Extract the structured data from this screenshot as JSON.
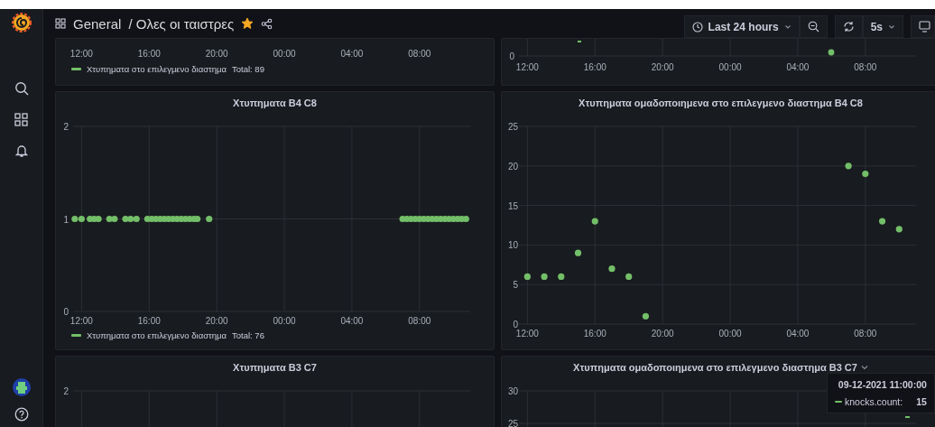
{
  "header": {
    "folder": "General",
    "title": "/ Ολες οι ταιστρες",
    "starred": true,
    "time_range": "Last 24 hours",
    "refresh_interval": "5s"
  },
  "panels": [
    {
      "kind": "top",
      "x_labels": [
        "12:00",
        "16:00",
        "20:00",
        "00:00",
        "04:00",
        "08:00"
      ],
      "legend": {
        "label": "Χτυπηματα στο επιλεγμενο διαστημα",
        "total": "Total: 89",
        "color": "#73bf69"
      }
    },
    {
      "kind": "top",
      "y_labels": [
        "0"
      ],
      "x_labels": [
        "12:00",
        "16:00",
        "20:00",
        "00:00",
        "04:00",
        "08:00"
      ]
    },
    {
      "kind": "chart",
      "title": "Χτυπηματα B4 C8",
      "legend": {
        "total": "Total: 76"
      },
      "chart_data": {
        "type": "scatter",
        "grid": true,
        "x": [
          "2021-12-08 11:36",
          "2021-12-08 12:00",
          "2021-12-08 12:30",
          "2021-12-08 12:45",
          "2021-12-08 13:00",
          "2021-12-08 13:39",
          "2021-12-08 13:57",
          "2021-12-08 14:36",
          "2021-12-08 14:54",
          "2021-12-08 15:15",
          "2021-12-08 15:54",
          "2021-12-08 16:09",
          "2021-12-08 16:24",
          "2021-12-08 16:39",
          "2021-12-08 16:54",
          "2021-12-08 17:09",
          "2021-12-08 17:24",
          "2021-12-08 17:39",
          "2021-12-08 17:54",
          "2021-12-08 18:09",
          "2021-12-08 18:24",
          "2021-12-08 18:39",
          "2021-12-08 18:51",
          "2021-12-08 19:33",
          "2021-12-09 07:00",
          "2021-12-09 07:15",
          "2021-12-09 07:30",
          "2021-12-09 07:45",
          "2021-12-09 08:00",
          "2021-12-09 08:15",
          "2021-12-09 08:30",
          "2021-12-09 08:45",
          "2021-12-09 09:00",
          "2021-12-09 09:15",
          "2021-12-09 09:30",
          "2021-12-09 09:45",
          "2021-12-09 10:00",
          "2021-12-09 10:15",
          "2021-12-09 10:30",
          "2021-12-09 10:45"
        ],
        "series": [
          {
            "name": "Χτυπηματα στο επιλεγμενο διαστημα",
            "color": "#73bf69",
            "values": [
              1,
              1,
              1,
              1,
              1,
              1,
              1,
              1,
              1,
              1,
              1,
              1,
              1,
              1,
              1,
              1,
              1,
              1,
              1,
              1,
              1,
              1,
              1,
              1,
              1,
              1,
              1,
              1,
              1,
              1,
              1,
              1,
              1,
              1,
              1,
              1,
              1,
              1,
              1,
              1
            ]
          }
        ],
        "xlim": [
          "2021-12-08 11:30",
          "2021-12-09 11:00"
        ],
        "ylim": [
          0,
          2
        ],
        "xticks": [
          {
            "value": "2021-12-08 12:00",
            "label": "12:00"
          },
          {
            "value": "2021-12-08 16:00",
            "label": "16:00"
          },
          {
            "value": "2021-12-08 20:00",
            "label": "20:00"
          },
          {
            "value": "2021-12-09 00:00",
            "label": "00:00"
          },
          {
            "value": "2021-12-09 04:00",
            "label": "04:00"
          },
          {
            "value": "2021-12-09 08:00",
            "label": "08:00"
          }
        ],
        "yticks": [
          0,
          1,
          2
        ]
      }
    },
    {
      "kind": "chart",
      "title": "Χτυπηματα ομαδοποιημενα στο επιλεγμενο διαστημα B4 C8",
      "chart_data": {
        "type": "scatter",
        "grid": true,
        "x": [
          "2021-12-08 12:00",
          "2021-12-08 13:00",
          "2021-12-08 14:00",
          "2021-12-08 15:00",
          "2021-12-08 16:00",
          "2021-12-08 17:00",
          "2021-12-08 18:00",
          "2021-12-08 19:00",
          "2021-12-09 07:00",
          "2021-12-09 08:00",
          "2021-12-09 09:00",
          "2021-12-09 10:00"
        ],
        "series": [
          {
            "color": "#73bf69",
            "values": [
              6,
              6,
              6,
              9,
              13,
              7,
              6,
              1,
              20,
              19,
              13,
              12
            ]
          }
        ],
        "xlim": [
          "2021-12-08 11:30",
          "2021-12-09 11:00"
        ],
        "ylim": [
          0,
          25
        ],
        "xticks": [
          {
            "value": "2021-12-08 12:00",
            "label": "12:00"
          },
          {
            "value": "2021-12-08 16:00",
            "label": "16:00"
          },
          {
            "value": "2021-12-08 20:00",
            "label": "20:00"
          },
          {
            "value": "2021-12-09 00:00",
            "label": "00:00"
          },
          {
            "value": "2021-12-09 04:00",
            "label": "04:00"
          },
          {
            "value": "2021-12-09 08:00",
            "label": "08:00"
          }
        ],
        "yticks": [
          0,
          5,
          10,
          15,
          20,
          25
        ]
      }
    },
    {
      "kind": "bottom",
      "title": "Χτυπηματα B3 C7",
      "y_labels": [
        "2"
      ]
    },
    {
      "kind": "bottom",
      "hovered": true,
      "title": "Χτυπηματα ομαδοποιημενα στο επιλεγμενο διαστημα B3 C7",
      "y_labels": [
        "30",
        "25"
      ],
      "tooltip": {
        "time": "09-12-2021 11:00:00",
        "series": "knocks.count:",
        "value": "15",
        "color": "#73bf69"
      }
    }
  ]
}
